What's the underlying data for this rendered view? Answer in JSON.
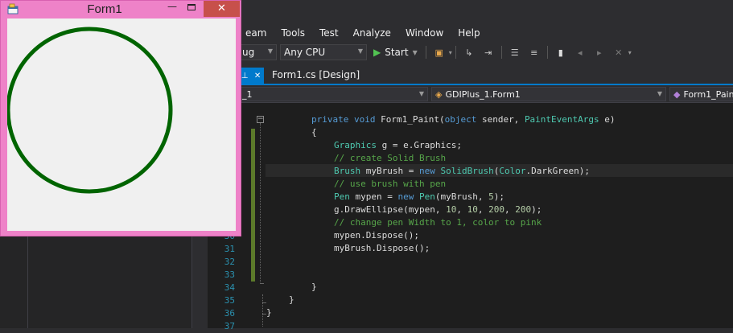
{
  "menu": [
    "eam",
    "Tools",
    "Test",
    "Analyze",
    "Window",
    "Help"
  ],
  "toolbar": {
    "config_value": "ug",
    "platform_value": "Any CPU",
    "start_label": "Start"
  },
  "tabs": {
    "design_tab": "Form1.cs [Design]"
  },
  "navbar": {
    "project_value": "_1",
    "class_value": "GDIPlus_1.Form1",
    "member_value": "Form1_Pain"
  },
  "editor": {
    "line_numbers": [
      "30",
      "31",
      "32",
      "33",
      "34",
      "35",
      "36",
      "37"
    ],
    "closing_braces": {
      "l34": "}",
      "l35": "}",
      "l36": "}"
    }
  },
  "code": {
    "l1": {
      "kw1": "private",
      "kw2": "void",
      "rest1": " Form1_Paint(",
      "kw3": "object",
      "rest2": " sender, ",
      "ty1": "PaintEventArgs",
      "rest3": " e)"
    },
    "l2": "{",
    "l3": {
      "ty1": "Graphics",
      "rest1": " g = e.Graphics;"
    },
    "l4": "// create Solid Brush",
    "l5": {
      "ty1": "Brush",
      "rest1": " myBrush = ",
      "kw1": "new",
      "sp": " ",
      "ty2": "SolidBrush",
      "rest2": "(",
      "ty3": "Color",
      "rest3": ".DarkGreen);"
    },
    "l6": "// use brush with pen",
    "l7": {
      "ty1": "Pen",
      "rest1": " mypen = ",
      "kw1": "new",
      "sp": " ",
      "ty2": "Pen",
      "rest2": "(myBrush, ",
      "n1": "5",
      "rest3": ");"
    },
    "l8": {
      "rest1": "g.DrawEllipse(mypen, ",
      "n1": "10",
      "c1": ", ",
      "n2": "10",
      "c2": ", ",
      "n3": "200",
      "c3": ", ",
      "n4": "200",
      "rest2": ");"
    },
    "l9": "// change pen Width to 1, color to pink",
    "l10": "mypen.Dispose();",
    "l11": "myBrush.Dispose();"
  },
  "form": {
    "title": "Form1",
    "close_glyph": "✕",
    "min_glyph": "—"
  },
  "colors": {
    "ellipse_stroke": "#006400",
    "form_background": "#ee82c8",
    "vs_accent": "#007acc"
  },
  "icons": [
    "form-app-icon",
    "play-icon",
    "find-icon",
    "bookmark-icon",
    "close-tab-icon",
    "pin-icon",
    "class-icon",
    "method-icon"
  ]
}
